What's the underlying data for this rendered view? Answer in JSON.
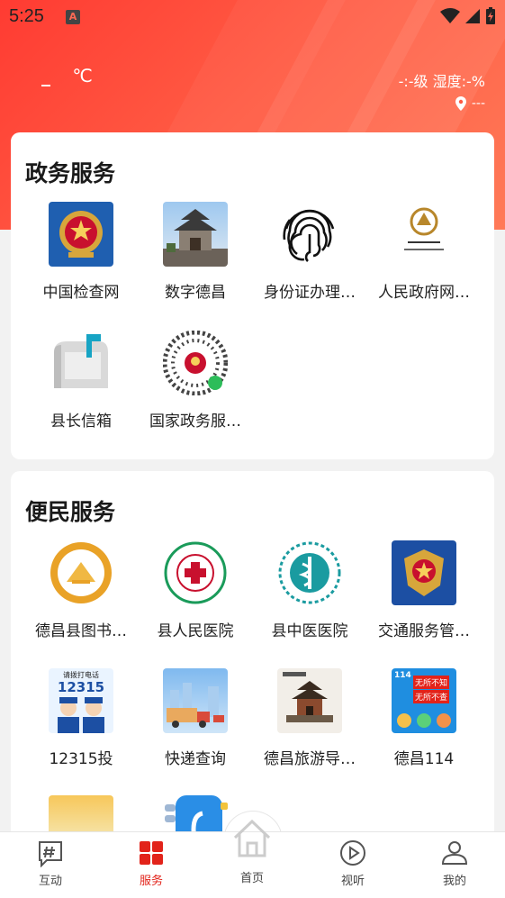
{
  "status_bar": {
    "time": "5:25",
    "notification_icon": "A"
  },
  "weather": {
    "temperature": "_",
    "unit": "℃",
    "wind_humidity": "-:-级  湿度:-%",
    "location": "---"
  },
  "government_services": {
    "title": "政务服务",
    "items": [
      {
        "label": "中国检查网",
        "icon": "procuratorate-emblem-icon"
      },
      {
        "label": "数字德昌",
        "icon": "pavilion-photo-icon"
      },
      {
        "label": "身份证办理…",
        "icon": "fingerprint-icon"
      },
      {
        "label": "人民政府网…",
        "icon": "dechang-logo-icon"
      },
      {
        "label": "县长信箱",
        "icon": "mailbox-icon"
      },
      {
        "label": "国家政务服…",
        "icon": "miniprogram-code-icon"
      }
    ]
  },
  "convenience_services": {
    "title": "便民服务",
    "items": [
      {
        "label": "德昌县图书…",
        "icon": "library-logo-icon"
      },
      {
        "label": "县人民医院",
        "icon": "hospital-logo-icon"
      },
      {
        "label": "县中医医院",
        "icon": "tcm-hospital-logo-icon"
      },
      {
        "label": "交通服务管…",
        "icon": "police-emblem-icon"
      },
      {
        "label": "12315投",
        "icon": "complaint-hotline-icon",
        "badge_text": "请拨打电话",
        "number": "12315"
      },
      {
        "label": "快递查询",
        "icon": "delivery-truck-icon"
      },
      {
        "label": "德昌旅游导…",
        "icon": "tourism-pagoda-icon"
      },
      {
        "label": "德昌114",
        "icon": "phone-114-icon",
        "badge_text": "114",
        "text_a": "无所不知",
        "text_b": "无所不查"
      },
      {
        "label": "",
        "icon": "sunset-photo-icon"
      },
      {
        "label": "",
        "icon": "phone-app-icon"
      }
    ]
  },
  "bottom_nav": {
    "items": [
      {
        "label": "互动",
        "icon": "hash-chat-icon",
        "active": false
      },
      {
        "label": "服务",
        "icon": "grid-icon",
        "active": true
      },
      {
        "label": "首页",
        "icon": "home-icon",
        "active": false
      },
      {
        "label": "视听",
        "icon": "play-circle-icon",
        "active": false
      },
      {
        "label": "我的",
        "icon": "user-icon",
        "active": false
      }
    ]
  },
  "colors": {
    "accent": "#e2231a",
    "hero_start": "#ff3b32",
    "hero_end": "#ff7a58"
  }
}
